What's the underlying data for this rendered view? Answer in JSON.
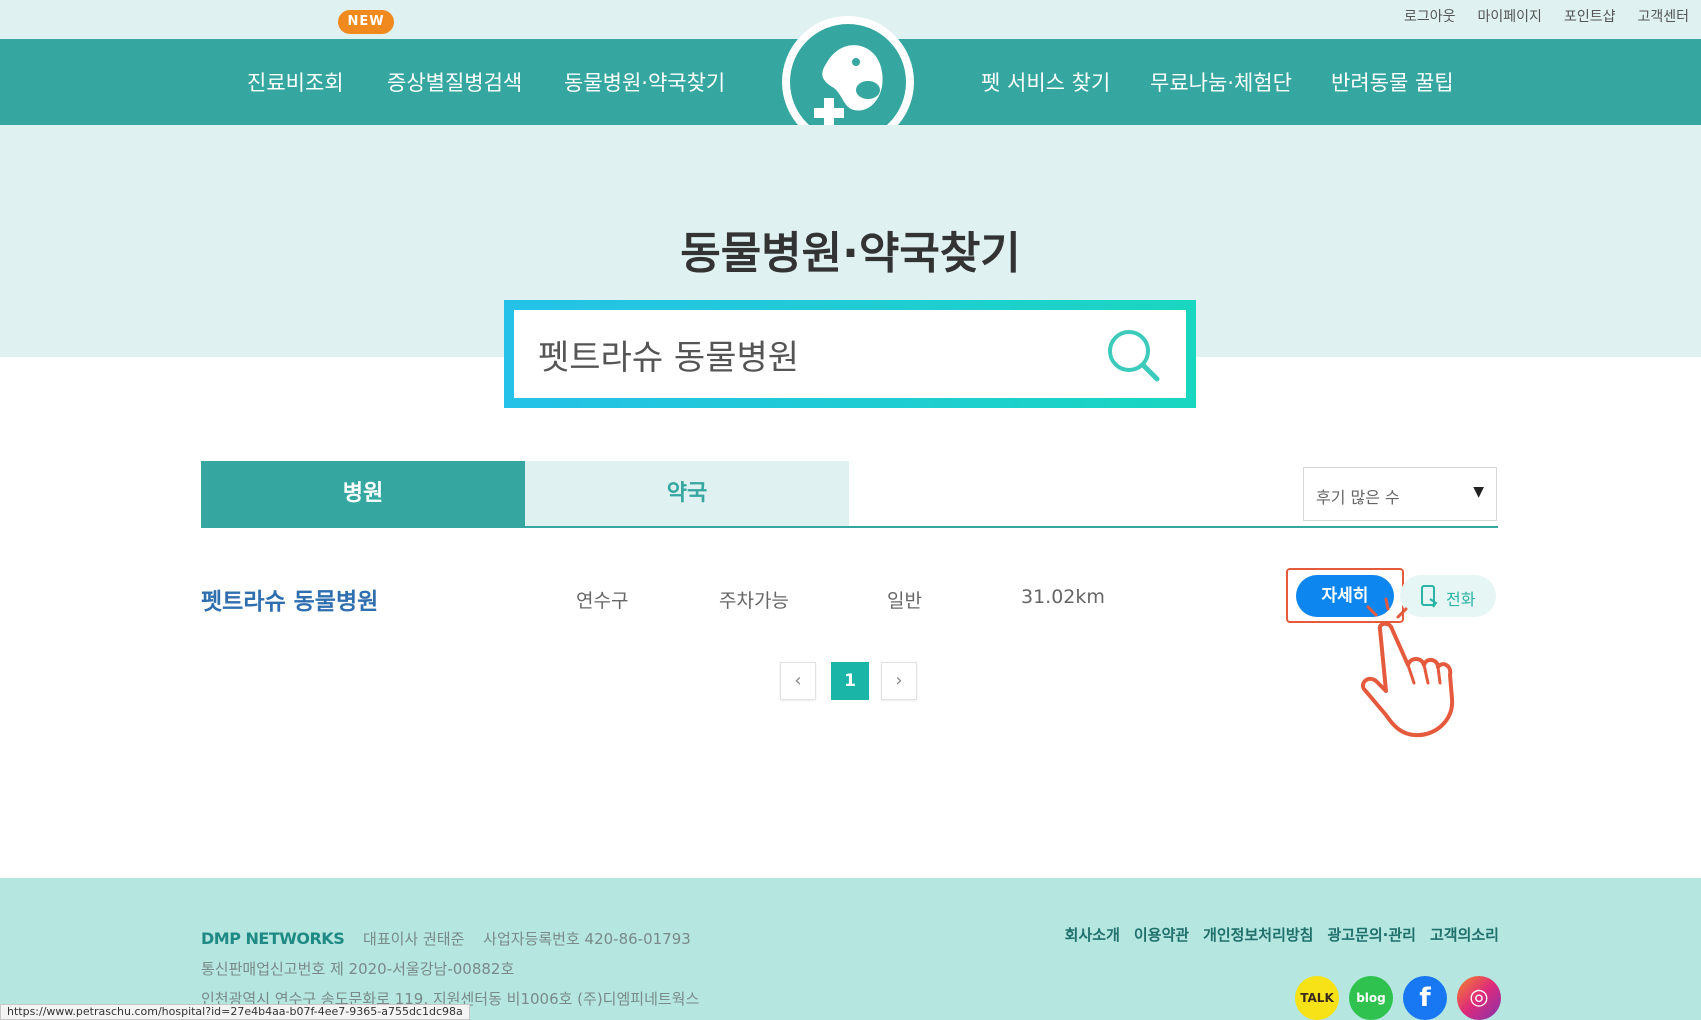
{
  "top_links": [
    "로그아웃",
    "마이페이지",
    "포인트샵",
    "고객센터"
  ],
  "nav": {
    "left": [
      "진료비조회",
      "증상별질병검색",
      "동물병원·약국찾기"
    ],
    "right": [
      "펫 서비스 찾기",
      "무료나눔·체험단",
      "반려동물 꿀팁"
    ],
    "new_badge": "NEW"
  },
  "page": {
    "title": "동물병원·약국찾기"
  },
  "search": {
    "value": "펫트라슈 동물병원"
  },
  "tabs": {
    "hospital": "병원",
    "pharmacy": "약국",
    "active": "병원"
  },
  "sort": {
    "selected": "후기 많은 수"
  },
  "results": [
    {
      "name": "펫트라슈 동물병원",
      "district": "연수구",
      "parking": "주차가능",
      "type": "일반",
      "distance": "31.02km"
    }
  ],
  "actions": {
    "detail": "자세히",
    "call": "전화"
  },
  "pagination": {
    "current": "1",
    "prev": "‹",
    "next": "›"
  },
  "footer": {
    "company": "DMP NETWORKS",
    "ceo": "대표이사 권태준",
    "biz_no": "사업자등록번호 420-86-01793",
    "mail_order": "통신판매업신고번호 제 2020-서울강남-00882호",
    "address": "인천광역시 연수구 송도문화로 119, 지원센터동 비1006호 (주)디엠피네트웍스",
    "links": [
      "회사소개",
      "이용약관",
      "개인정보처리방침",
      "광고문의·관리",
      "고객의소리"
    ],
    "social_kakao": "TALK",
    "social_blog": "blog",
    "social_fb": "f",
    "social_insta": "◎"
  },
  "status_url": "https://www.petraschu.com/hospital?id=27e4b4aa-b07f-4ee7-9365-a755dc1dc98a",
  "colors": {
    "teal": "#35a6a0",
    "mint_bg": "#dff2f1",
    "blue_button": "#0e86f0",
    "badge_orange": "#f08a1e",
    "footer_bg": "#b5e6e0"
  }
}
